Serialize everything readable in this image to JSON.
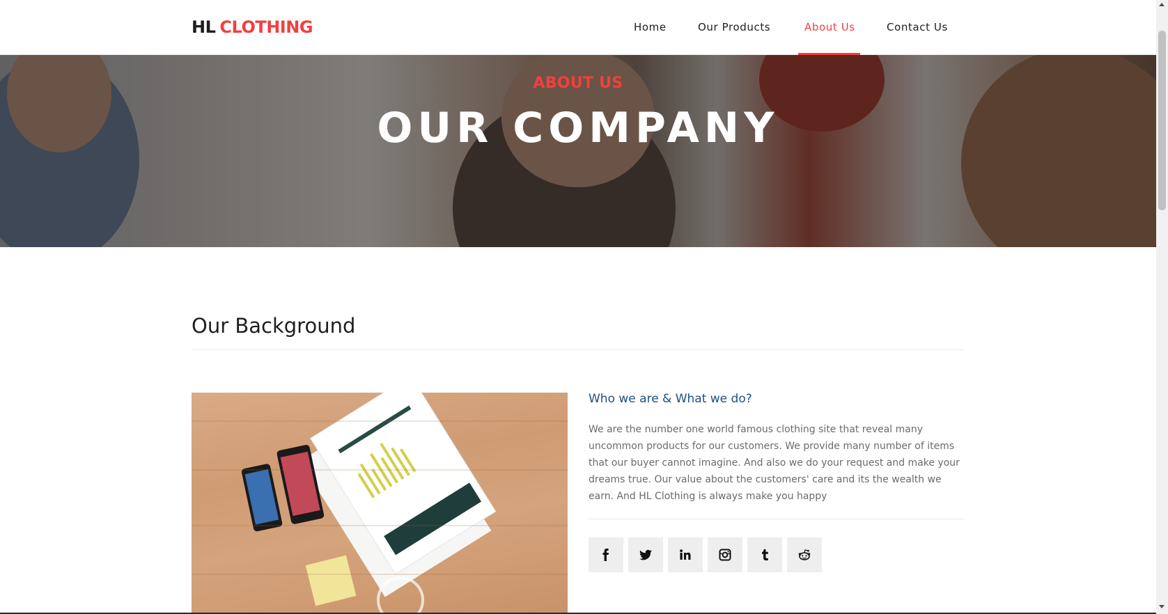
{
  "brand": {
    "part1": "HL",
    "part2": "CLOTHING",
    "accent": "#f33f3f"
  },
  "nav": {
    "items": [
      {
        "label": "Home"
      },
      {
        "label": "Our Products"
      },
      {
        "label": "About Us",
        "active": true
      },
      {
        "label": "Contact Us"
      }
    ]
  },
  "hero": {
    "subtitle": "ABOUT US",
    "title": "OUR COMPANY"
  },
  "section": {
    "title": "Our Background",
    "heading": "Who we are & What we do?",
    "description": "We are the number one world famous clothing site that reveal many uncommon products for our customers. We provide many number of items that our buyer cannot imagine. And also we do your request and make your dreams true. Our value about the customers' care and its the wealth we earn. And HL Clothing is always make you happy"
  },
  "social": {
    "icons": [
      "facebook-icon",
      "twitter-icon",
      "linkedin-icon",
      "instagram-icon",
      "tumblr-icon",
      "reddit-icon"
    ]
  },
  "colors": {
    "accent": "#f33f3f",
    "heading_blue": "#1d4f82",
    "text": "#1e1e1e",
    "muted": "#6b6b6b"
  }
}
